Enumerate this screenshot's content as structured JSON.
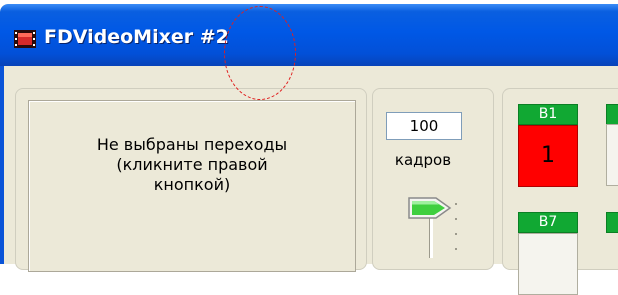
{
  "window": {
    "title": "FDVideoMixer #2"
  },
  "transitions_panel": {
    "message": "Не выбраны переходы\n(кликните правой\nкнопкой)"
  },
  "frames": {
    "value": "100",
    "label": "кадров"
  },
  "buttons": [
    {
      "label": "B1",
      "value": "1"
    },
    {
      "label": "B7",
      "value": ""
    }
  ],
  "colors": {
    "titlebar": "#0058e6",
    "button_header": "#11a833",
    "button_active": "#ff0000",
    "annotation": "#e02020"
  },
  "icons": {
    "app": "film-strip-icon",
    "slider_thumb": "slider-arrow-icon"
  }
}
